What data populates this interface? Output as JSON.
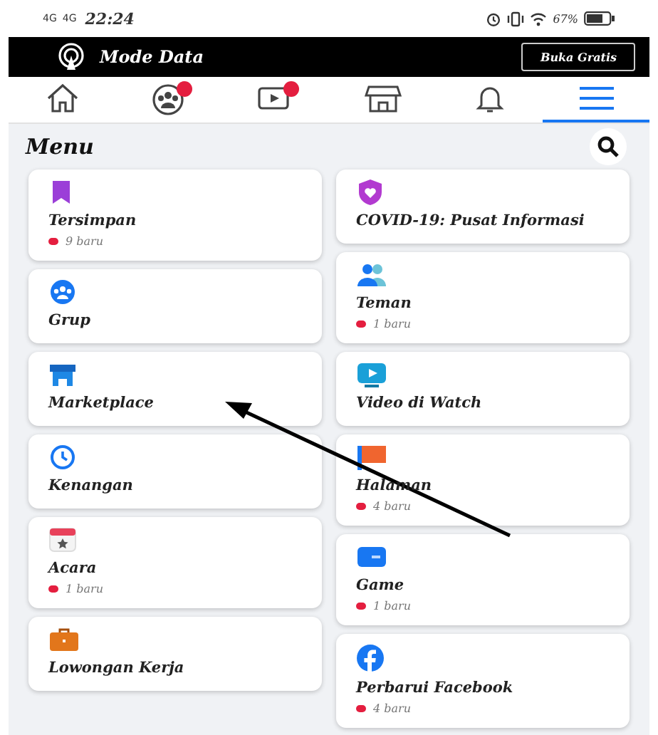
{
  "status_bar": {
    "network_1": "4G",
    "network_2": "4G",
    "time": "22:24",
    "battery": "67%"
  },
  "data_bar": {
    "label": "Mode Data",
    "button": "Buka Gratis"
  },
  "nav_tabs": [
    {
      "kind": "home",
      "selected": false,
      "badge": false
    },
    {
      "kind": "groups",
      "selected": false,
      "badge": true
    },
    {
      "kind": "video",
      "selected": false,
      "badge": true
    },
    {
      "kind": "marketplace",
      "selected": false,
      "badge": false
    },
    {
      "kind": "bell",
      "selected": false,
      "badge": false
    },
    {
      "kind": "menu",
      "selected": true,
      "badge": false
    }
  ],
  "header": {
    "title": "Menu"
  },
  "columns": [
    [
      {
        "kind": "bookmark",
        "title": "Tersimpan",
        "note": "9 baru"
      },
      {
        "kind": "groups",
        "title": "Grup"
      },
      {
        "kind": "shop",
        "title": "Marketplace"
      },
      {
        "kind": "clock",
        "title": "Kenangan"
      },
      {
        "kind": "calendar",
        "title": "Acara",
        "note": "1 baru"
      },
      {
        "kind": "briefcase",
        "title": "Lowongan Kerja"
      }
    ],
    [
      {
        "kind": "shield",
        "title": "COVID-19: Pusat Informasi"
      },
      {
        "kind": "friends",
        "title": "Teman",
        "note": "1 baru"
      },
      {
        "kind": "play",
        "title": "Video di Watch"
      },
      {
        "kind": "flag",
        "title": "Halaman",
        "note": "4 baru"
      },
      {
        "kind": "game",
        "title": "Game",
        "note": "1 baru"
      },
      {
        "kind": "facebook",
        "title": "Perbarui Facebook",
        "note": "4 baru"
      }
    ]
  ]
}
